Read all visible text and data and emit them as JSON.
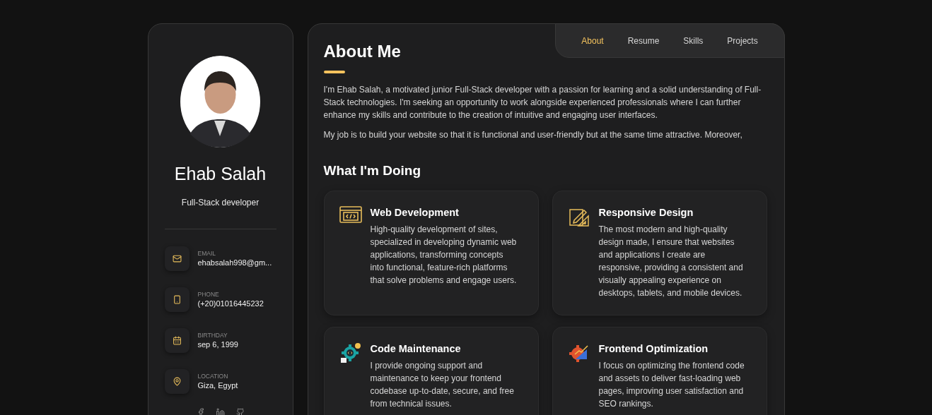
{
  "profile": {
    "name": "Ehab Salah",
    "role": "Full-Stack developer"
  },
  "contacts": [
    {
      "kind": "email",
      "label": "EMAIL",
      "value": "ehabsalah998@gm..."
    },
    {
      "kind": "phone",
      "label": "PHONE",
      "value": "(+20)01016445232"
    },
    {
      "kind": "birthday",
      "label": "BIRTHDAY",
      "value": "sep 6, 1999"
    },
    {
      "kind": "location",
      "label": "LOCATION",
      "value": "Giza, Egypt"
    }
  ],
  "nav": [
    {
      "label": "About",
      "selected": true
    },
    {
      "label": "Resume",
      "selected": false
    },
    {
      "label": "Skills",
      "selected": false
    },
    {
      "label": "Projects",
      "selected": false
    }
  ],
  "about": {
    "title": "About Me",
    "paragraphs": [
      "I'm Ehab Salah, a motivated junior Full-Stack developer with a passion for learning and a solid understanding of Full-Stack technologies. I'm seeking an opportunity to work alongside experienced professionals where I can further enhance my skills and contribute to the creation of intuitive and engaging user interfaces.",
      "My job is to build your website so that it is functional and user-friendly but at the same time attractive. Moreover,"
    ]
  },
  "services": {
    "title": "What I'm Doing",
    "items": [
      {
        "kind": "web",
        "title": "Web Development",
        "text": "High-quality development of sites, specialized in developing dynamic web applications, transforming concepts into functional, feature-rich platforms that solve problems and engage users."
      },
      {
        "kind": "design",
        "title": "Responsive Design",
        "text": "The most modern and high-quality design made, I ensure that websites and applications I create are responsive, providing a consistent and visually appealing experience on desktops, tablets, and mobile devices."
      },
      {
        "kind": "maintenance",
        "title": "Code Maintenance",
        "text": "I provide ongoing support and maintenance to keep your frontend codebase up-to-date, secure, and free from technical issues."
      },
      {
        "kind": "optimization",
        "title": "Frontend Optimization",
        "text": "I focus on optimizing the frontend code and assets to deliver fast-loading web pages, improving user satisfaction and SEO rankings."
      }
    ]
  }
}
